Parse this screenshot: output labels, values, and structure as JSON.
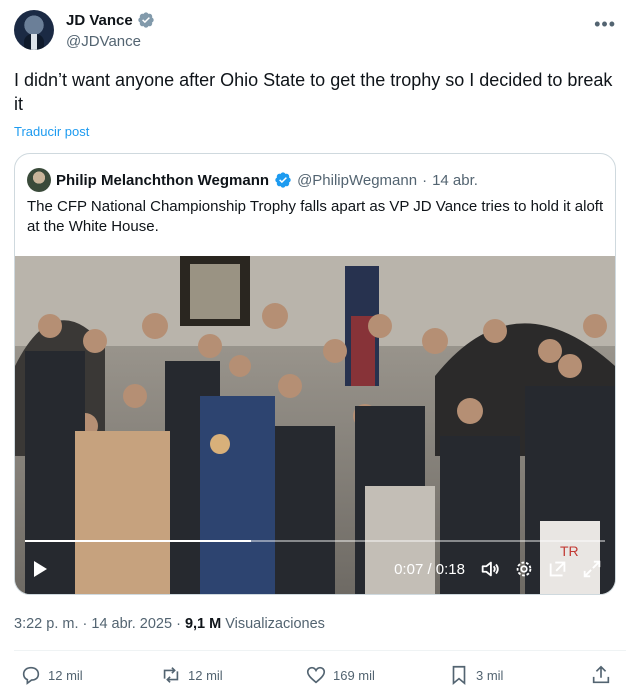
{
  "author": {
    "name": "JD Vance",
    "handle": "@JDVance"
  },
  "tweet": {
    "text": "I didn’t want anyone after Ohio State to get the trophy so I decided to break it",
    "translate_label": "Traducir post"
  },
  "quote": {
    "name": "Philip Melanchthon Wegmann",
    "handle": "@PhilipWegmann",
    "separator": "·",
    "date": "14 abr.",
    "text": "The CFP National Championship Trophy falls apart as VP JD Vance tries to hold it aloft at the White House.",
    "video": {
      "time_display": "0:07 / 0:18",
      "progress": 0.39
    }
  },
  "meta": {
    "time": "3:22 p. m.",
    "separator": "·",
    "date": "14 abr. 2025",
    "views": "9,1 M",
    "views_label": "Visualizaciones"
  },
  "actions": {
    "replies": "12 mil",
    "reposts": "12 mil",
    "likes": "169 mil",
    "bookmarks": "3 mil"
  },
  "colors": {
    "accent": "#1d9bf0",
    "muted": "#536471",
    "border": "#cfd9de"
  }
}
